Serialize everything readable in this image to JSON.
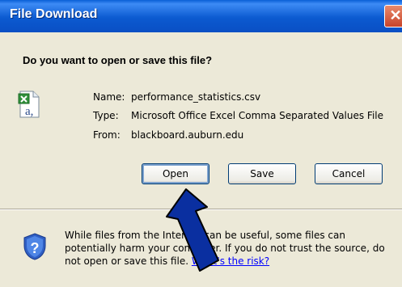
{
  "dialog": {
    "title": "File Download",
    "close_glyph": "✕",
    "question": "Do you want to open or save this file?"
  },
  "file": {
    "icon": "excel-csv-icon",
    "name_label": "Name:",
    "name_value": "performance_statistics.csv",
    "type_label": "Type:",
    "type_value": "Microsoft Office Excel Comma Separated Values File",
    "from_label": "From:",
    "from_value": "blackboard.auburn.edu"
  },
  "buttons": {
    "open": "Open",
    "save": "Save",
    "cancel": "Cancel"
  },
  "warning": {
    "text": "While files from the Internet can be useful, some files can potentially harm your computer. If you do not trust the source, do not open or save this file.",
    "link": "What's the risk?"
  },
  "annotation": {
    "arrow_color": "#0a2fa0"
  }
}
